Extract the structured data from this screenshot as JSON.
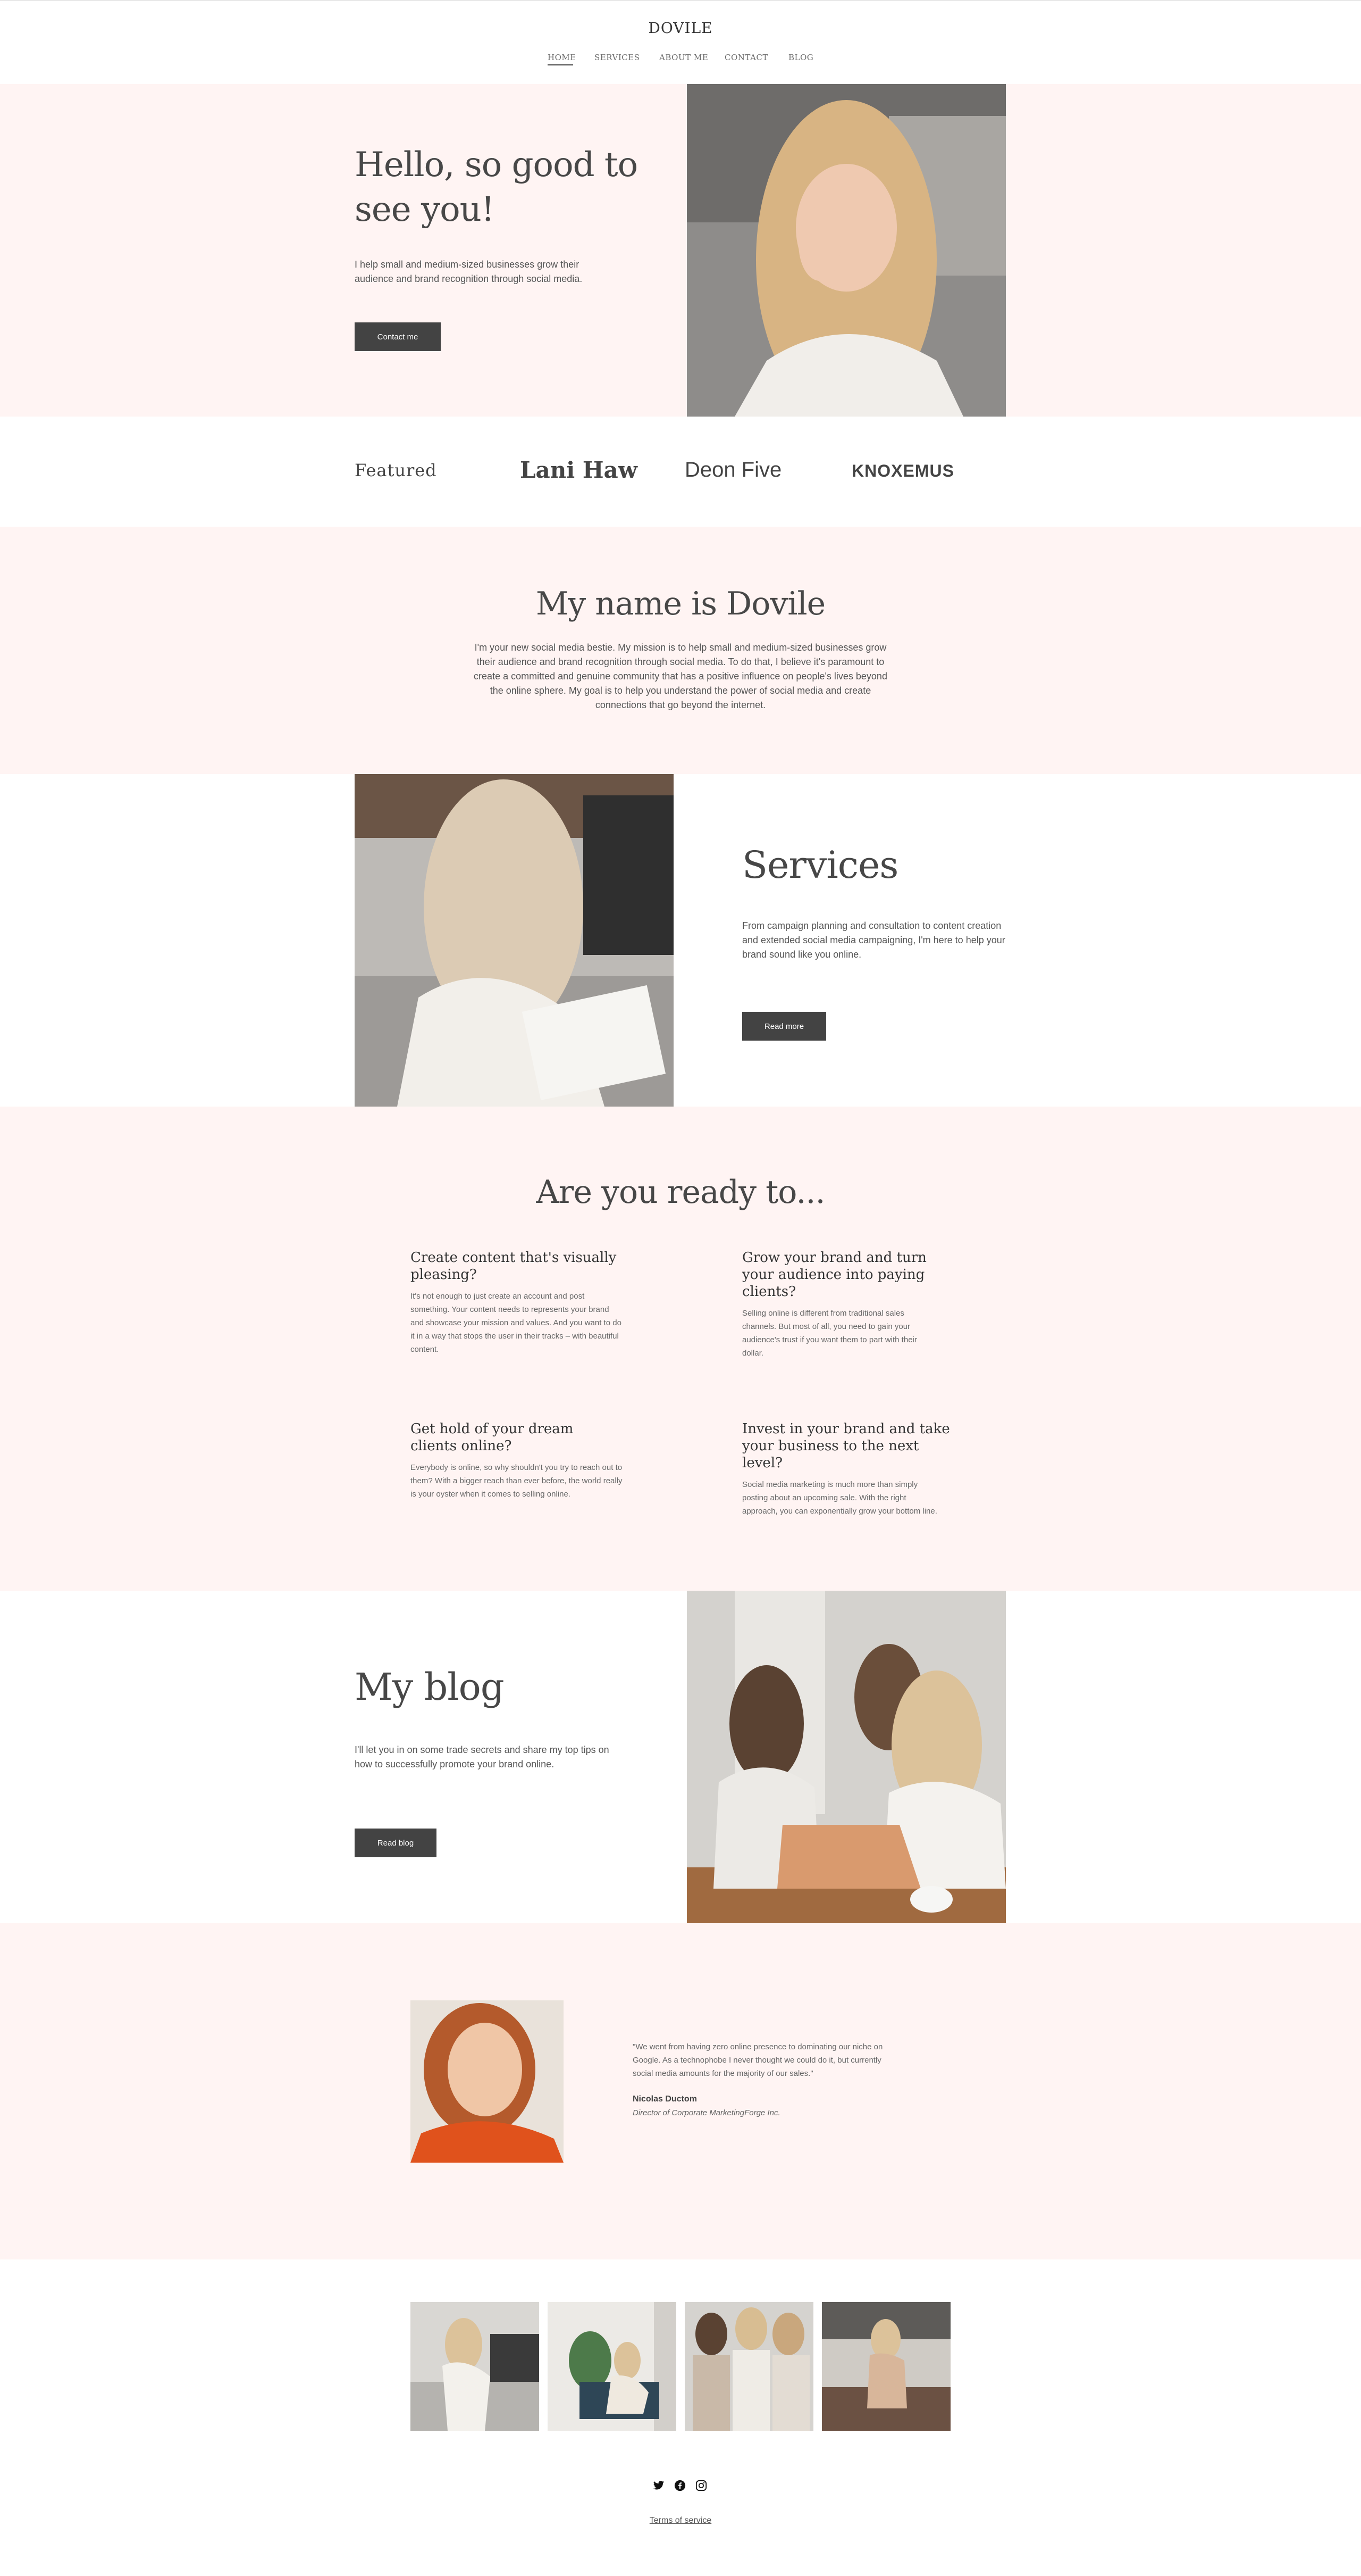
{
  "header": {
    "brand": "DOVILE",
    "nav": [
      "HOME",
      "SERVICES",
      "ABOUT ME",
      "CONTACT",
      "BLOG"
    ]
  },
  "hero": {
    "title_line1": "Hello, so good to",
    "title_line2": "see you!",
    "text": "I help small and medium-sized businesses grow their audience and brand recognition through social media.",
    "button": "Contact me"
  },
  "featured": {
    "label": "Featured",
    "logos": [
      "Lani Haw",
      "Deon Five",
      "KNOXEMUS"
    ]
  },
  "about": {
    "title": "My name is Dovile",
    "text": "I'm your new social media bestie. My mission is to help small and medium-sized businesses grow their audience and brand recognition through social media. To do that, I believe it's paramount to create a committed and genuine community that has a positive influence on people's lives beyond the online sphere. My goal is to help you understand the power of social media and create connections that go beyond the internet."
  },
  "services": {
    "title": "Services",
    "text": "From campaign planning and consultation to content creation and extended social media campaigning, I'm here to help your brand sound like you online.",
    "button": "Read more"
  },
  "ready": {
    "title": "Are you ready to...",
    "items": [
      {
        "title": "Create content that's visually pleasing?",
        "text": "It's not enough to just create an account and post something. Your content needs to represents your brand and showcase your mission and values. And you want to do it in a way that stops the user in their tracks – with beautiful content."
      },
      {
        "title": "Grow your brand and turn your audience into paying clients?",
        "text": "Selling online is different from traditional sales channels. But most of all, you need to gain your audience's trust if you want them to part with their dollar."
      },
      {
        "title": "Get hold of your dream clients online?",
        "text": "Everybody is online, so why shouldn't you try to reach out to them? With a bigger reach than ever before, the world really is your oyster when it comes to selling online."
      },
      {
        "title": "Invest in your brand and take your business to the next level?",
        "text": "Social media marketing is much more than simply posting about an upcoming sale. With the right approach, you can exponentially grow your bottom line."
      }
    ]
  },
  "blog": {
    "title": "My blog",
    "text": "I'll let you in on some trade secrets and share my top tips on how to successfully promote your brand online.",
    "button": "Read blog"
  },
  "testimonial": {
    "quote": "\"We went from having zero online presence to dominating our niche on Google. As a technophobe I never thought we could do it, but currently social media amounts for the majority of our sales.\"",
    "name": "Nicolas Ductom",
    "role": "Director of Corporate MarketingForge Inc."
  },
  "footer": {
    "social_icons": [
      "twitter-icon",
      "facebook-icon",
      "instagram-icon"
    ],
    "terms": "Terms of service"
  },
  "colors": {
    "pink_bg": "#fff4f3",
    "button": "#434343",
    "text": "#4a4a4a"
  }
}
